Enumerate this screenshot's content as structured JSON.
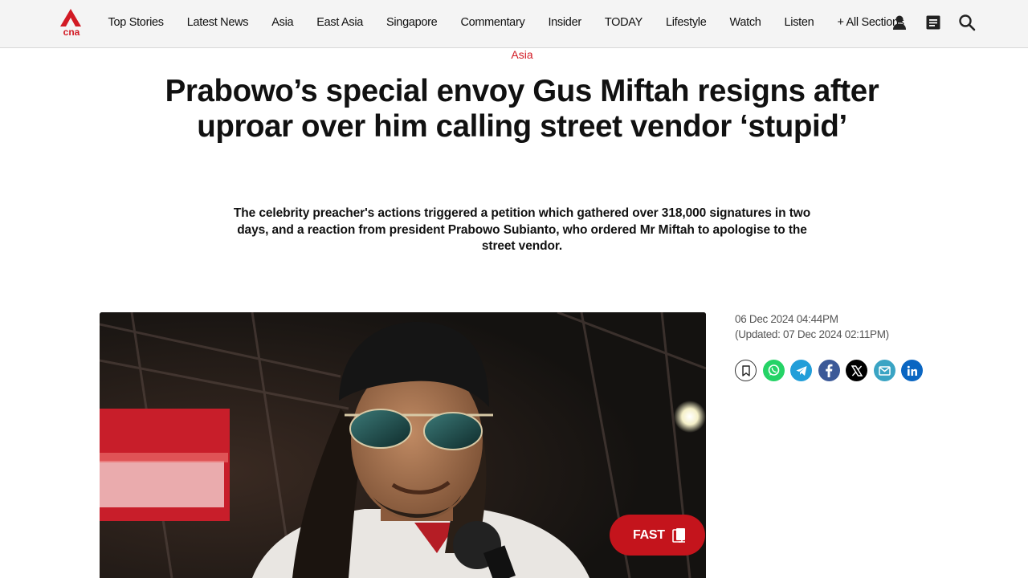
{
  "header": {
    "logo_text": "cna",
    "nav": [
      "Top Stories",
      "Latest News",
      "Asia",
      "East Asia",
      "Singapore",
      "Commentary",
      "Insider",
      "TODAY",
      "Lifestyle",
      "Watch",
      "Listen",
      "+ All Sections"
    ],
    "icons": [
      "user-icon",
      "reader-list-icon",
      "search-icon"
    ]
  },
  "article": {
    "section": "Asia",
    "title": "Prabowo’s special envoy Gus Miftah resigns after uproar over him calling street vendor ‘stupid’",
    "summary": "The celebrity preacher's actions triggered a petition which gathered over 318,000 signatures in two days, and a reaction from president Prabowo Subianto, who ordered Mr Miftah to apologise to the street vendor.",
    "published": "06 Dec 2024 04:44PM",
    "updated": "(Updated: 07 Dec 2024 02:11PM)",
    "fast_label": "FAST"
  },
  "share": [
    {
      "icon": "bookmark-icon",
      "color": "#ffffff"
    },
    {
      "icon": "whatsapp-icon",
      "color": "#25d366"
    },
    {
      "icon": "telegram-icon",
      "color": "#229ed9"
    },
    {
      "icon": "facebook-icon",
      "color": "#3b5998"
    },
    {
      "icon": "x-icon",
      "color": "#000000"
    },
    {
      "icon": "email-icon",
      "color": "#3aa4c4"
    },
    {
      "icon": "linkedin-icon",
      "color": "#0a66c2"
    }
  ],
  "colors": {
    "brand_red": "#d21a24",
    "fast_red": "#c4141c",
    "header_bg": "#f4f4f4"
  }
}
